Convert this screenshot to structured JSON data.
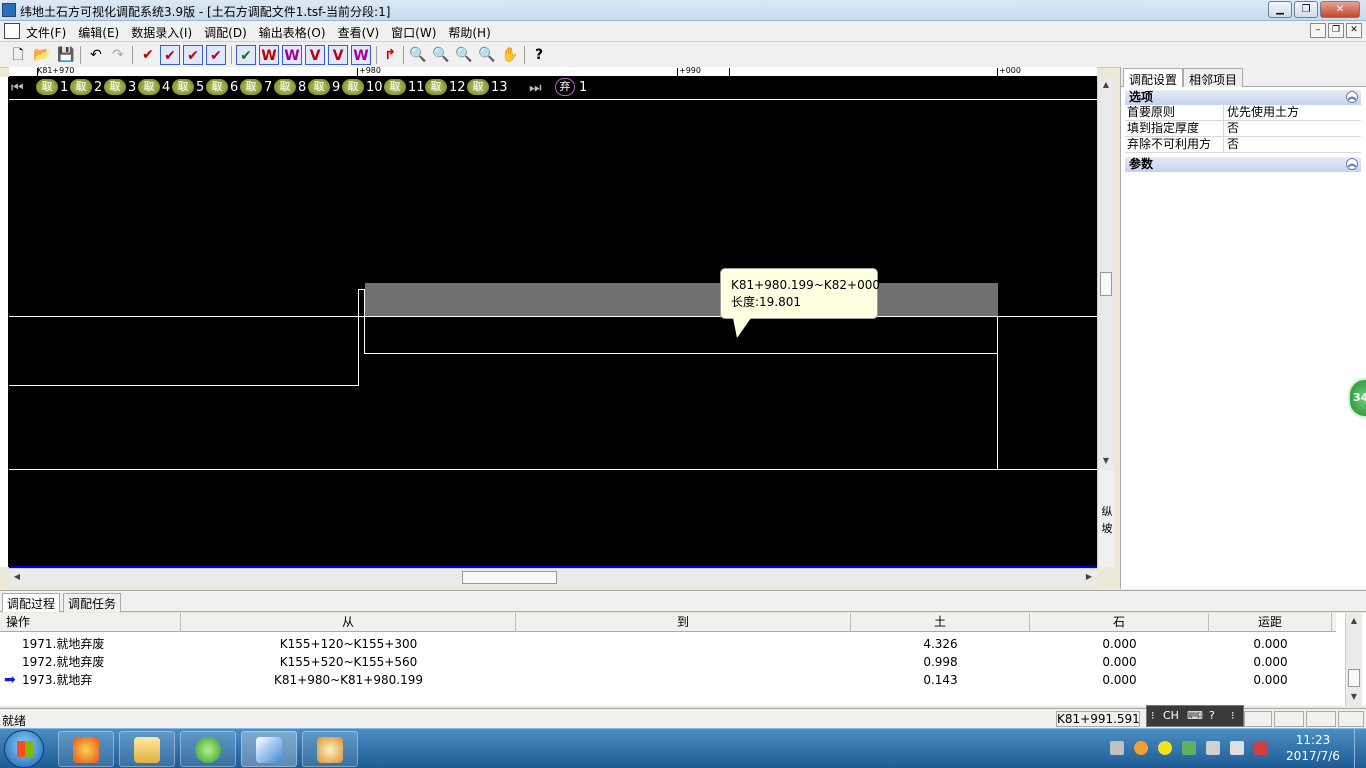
{
  "window": {
    "title": "纬地土石方可视化调配系统3.9版 - [土石方调配文件1.tsf-当前分段:1]"
  },
  "menu": [
    "文件(F)",
    "编辑(E)",
    "数据录入(I)",
    "调配(D)",
    "输出表格(O)",
    "查看(V)",
    "窗口(W)",
    "帮助(H)"
  ],
  "toolbar_icons": [
    "new-icon",
    "open-icon",
    "save-icon",
    "undo-icon",
    "redo-icon",
    "check-icon",
    "check-box-icon",
    "check-multi-icon",
    "check-edit-icon",
    "verify-icon",
    "verify-w-icon",
    "verify-w2-icon",
    "verify-v-icon",
    "verify-v2-icon",
    "verify-v3-icon",
    "return-icon",
    "zoom-in-icon",
    "zoom-out-icon",
    "zoom-fit-icon",
    "zoom-window-icon",
    "pan-icon",
    "help-icon"
  ],
  "ruler": {
    "labels": [
      "K81+970",
      "+980",
      "+990",
      "+000"
    ]
  },
  "segments": {
    "take_label": "取",
    "numbers": [
      "1",
      "2",
      "3",
      "4",
      "5",
      "6",
      "7",
      "8",
      "9",
      "10",
      "11",
      "12",
      "13"
    ],
    "abandon_label": "弃",
    "abandon_number": "1"
  },
  "tooltip": {
    "range": "K81+980.199~K82+000",
    "length": "长度:19.801"
  },
  "vslope_label": "纵坡",
  "right_panel": {
    "tabs": [
      "调配设置",
      "相邻项目"
    ],
    "options_header": "选项",
    "options": [
      {
        "key": "首要原则",
        "value": "优先使用土方"
      },
      {
        "key": "填到指定厚度",
        "value": "否"
      },
      {
        "key": "弃除不可利用方",
        "value": "否"
      }
    ],
    "params_header": "参数",
    "badge": "34"
  },
  "bottom_tabs": [
    "调配过程",
    "调配任务"
  ],
  "table": {
    "columns": [
      "操作",
      "从",
      "到",
      "土",
      "石",
      "运距"
    ],
    "rows": [
      {
        "op": "1971.就地弃废",
        "from": "K155+120~K155+300",
        "to": "",
        "soil": "4.326",
        "rock": "0.000",
        "dist": "0.000",
        "current": false
      },
      {
        "op": "1972.就地弃废",
        "from": "K155+520~K155+560",
        "to": "",
        "soil": "0.998",
        "rock": "0.000",
        "dist": "0.000",
        "current": false
      },
      {
        "op": "1973.就地弃",
        "from": "K81+980~K81+980.199",
        "to": "",
        "soil": "0.143",
        "rock": "0.000",
        "dist": "0.000",
        "current": true
      }
    ]
  },
  "status": {
    "text": "就绪",
    "coord": "K81+991.591"
  },
  "ime": {
    "label": "CH"
  },
  "clock": {
    "time": "11:23",
    "date": "2017/7/6"
  }
}
